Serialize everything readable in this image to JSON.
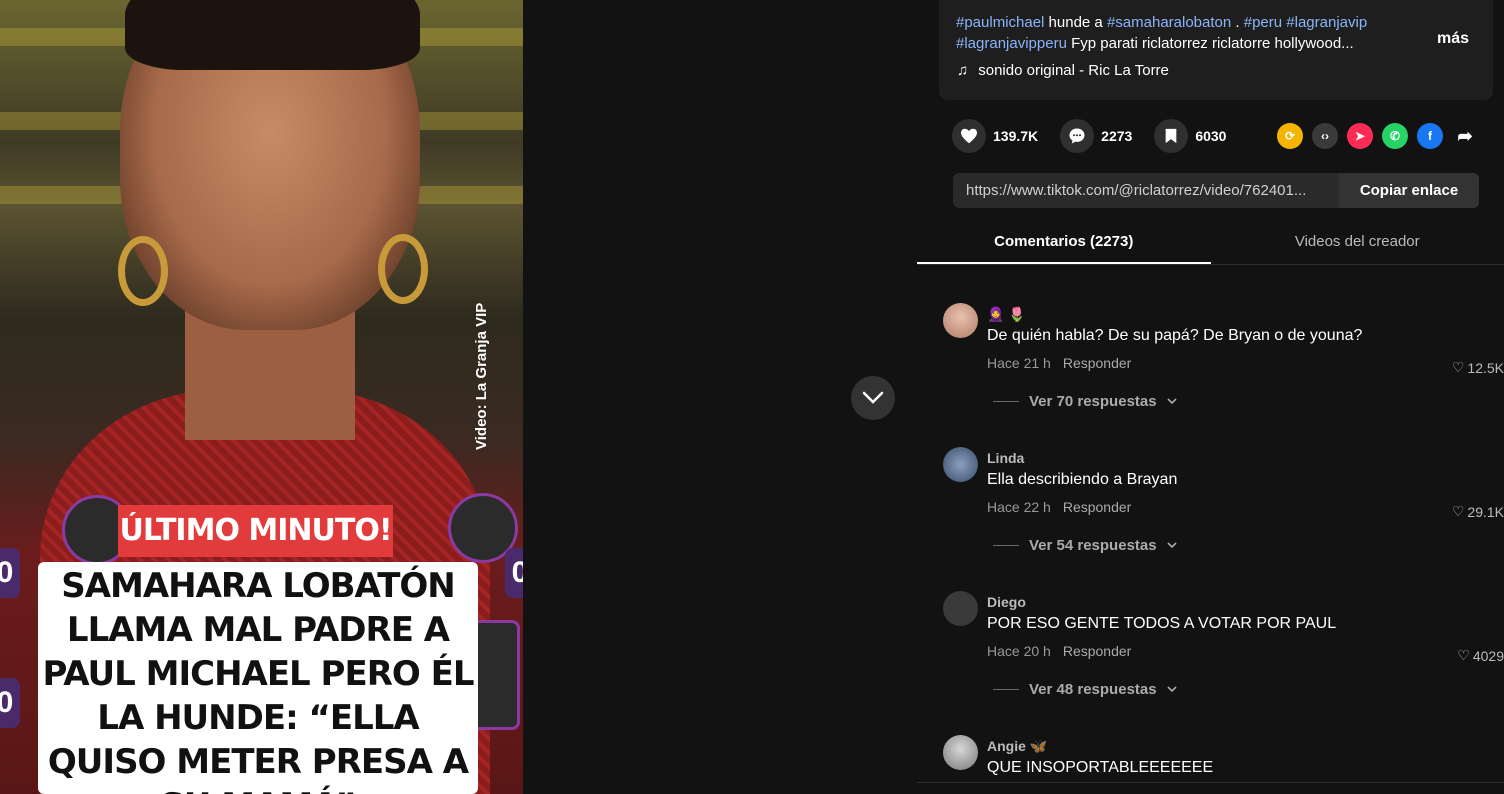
{
  "video": {
    "credit": "Video: La Granja VIP",
    "badge": "ÚLTIMO MINUTO!",
    "headline": "SAMAHARA LOBATÓN LLAMA MAL PADRE A PAUL MICHAEL PERO ÉL LA HUNDE: “ELLA QUISO METER PRESA A SU MAMÁ”",
    "side_left_top": "0",
    "side_left_bottom": "0",
    "side_right": "0"
  },
  "description": {
    "tag1": "#paulmichael",
    "text1": " hunde a ",
    "tag2": "#samaharalobaton",
    "text2": " . ",
    "tag3": "#peru",
    "tag4": "#lagranjavip",
    "tag5": "#lagranjavipperu",
    "text3": " Fyp parati riclatorrez riclatorre hollywood...",
    "more": "más",
    "sound": "sonido original - Ric La Torre"
  },
  "actions": {
    "likes": "139.7K",
    "comments": "2273",
    "saves": "6030"
  },
  "share_icons": [
    {
      "name": "repost-icon",
      "color": "#f4b400"
    },
    {
      "name": "embed-icon",
      "color": "#3a3a3a"
    },
    {
      "name": "send-icon",
      "color": "#fe2c55"
    },
    {
      "name": "whatsapp-icon",
      "color": "#25d366"
    },
    {
      "name": "facebook-icon",
      "color": "#1877f2"
    }
  ],
  "link": {
    "url": "https://www.tiktok.com/@riclatorrez/video/762401...",
    "copy_label": "Copiar enlace"
  },
  "tabs": {
    "comments": "Comentarios (2273)",
    "creator_videos": "Videos del creador"
  },
  "comments": [
    {
      "user": "🧕 🌷",
      "text": "De quién habla? De su papá? De Bryan o de youna?",
      "time": "Hace 21 h",
      "reply": "Responder",
      "likes": "12.5K",
      "replies": "Ver 70 respuestas"
    },
    {
      "user": "Linda",
      "text": "Ella describiendo a Brayan",
      "time": "Hace 22 h",
      "reply": "Responder",
      "likes": "29.1K",
      "replies": "Ver 54 respuestas"
    },
    {
      "user": "Diego",
      "text": "POR ESO GENTE TODOS A VOTAR POR PAUL",
      "time": "Hace 20 h",
      "reply": "Responder",
      "likes": "4029",
      "replies": "Ver 48 respuestas"
    },
    {
      "user": "Angie 🦋",
      "text": "QUE INSOPORTABLEEEEEEE"
    }
  ]
}
